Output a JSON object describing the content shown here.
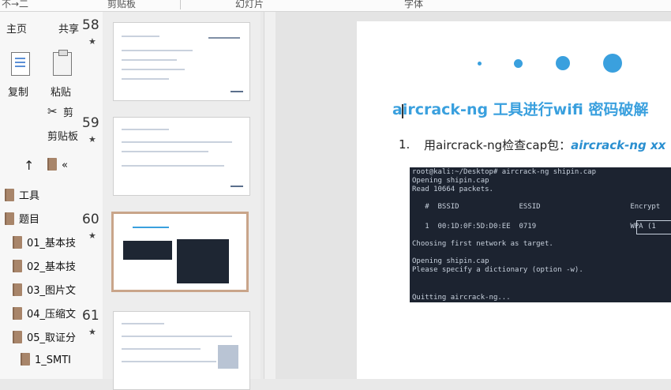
{
  "ribbon": {
    "fragment": "不→二",
    "clipboard_group": "剪贴板",
    "slides_group": "幻灯片",
    "font_group": "字体"
  },
  "left_tabs": {
    "home": "主页",
    "share": "共享"
  },
  "ribbon_buttons": {
    "copy": "复制",
    "paste": "粘贴",
    "cut": "剪",
    "clipboard": "剪贴板",
    "up_arrow": "↑",
    "collapse": "«"
  },
  "tree": {
    "items": [
      {
        "label": "工具"
      },
      {
        "label": "题目"
      },
      {
        "label": "01_基本技"
      },
      {
        "label": "02_基本技"
      },
      {
        "label": "03_图片文"
      },
      {
        "label": "04_压缩文"
      },
      {
        "label": "05_取证分"
      },
      {
        "label": "1_SMTI"
      }
    ]
  },
  "slides": [
    {
      "number": "58",
      "star": "★"
    },
    {
      "number": "59",
      "star": "★"
    },
    {
      "number": "60",
      "star": "★"
    },
    {
      "number": "61",
      "star": "★"
    }
  ],
  "main_slide": {
    "title": "aircrack-ng 工具进行wifi 密码破解",
    "step_number": "1.",
    "step_text": "用aircrack-ng检查cap包：",
    "step_command": "aircrack-ng xx",
    "terminal_lines": [
      "root@kali:~/Desktop# aircrack-ng shipin.cap",
      "Opening shipin.cap",
      "Read 10664 packets.",
      "",
      "   #  BSSID              ESSID                     Encrypt",
      "",
      "   1  00:1D:0F:5D:D0:EE  0719                      WPA (1",
      "",
      "Choosing first network as target.",
      "",
      "Opening shipin.cap",
      "Please specify a dictionary (option -w).",
      "",
      "",
      "Quitting aircrack-ng..."
    ]
  },
  "colors": {
    "accent": "#3aa0de",
    "terminal_bg": "#1c2330",
    "selected_thumb_border": "#c9a58a"
  }
}
